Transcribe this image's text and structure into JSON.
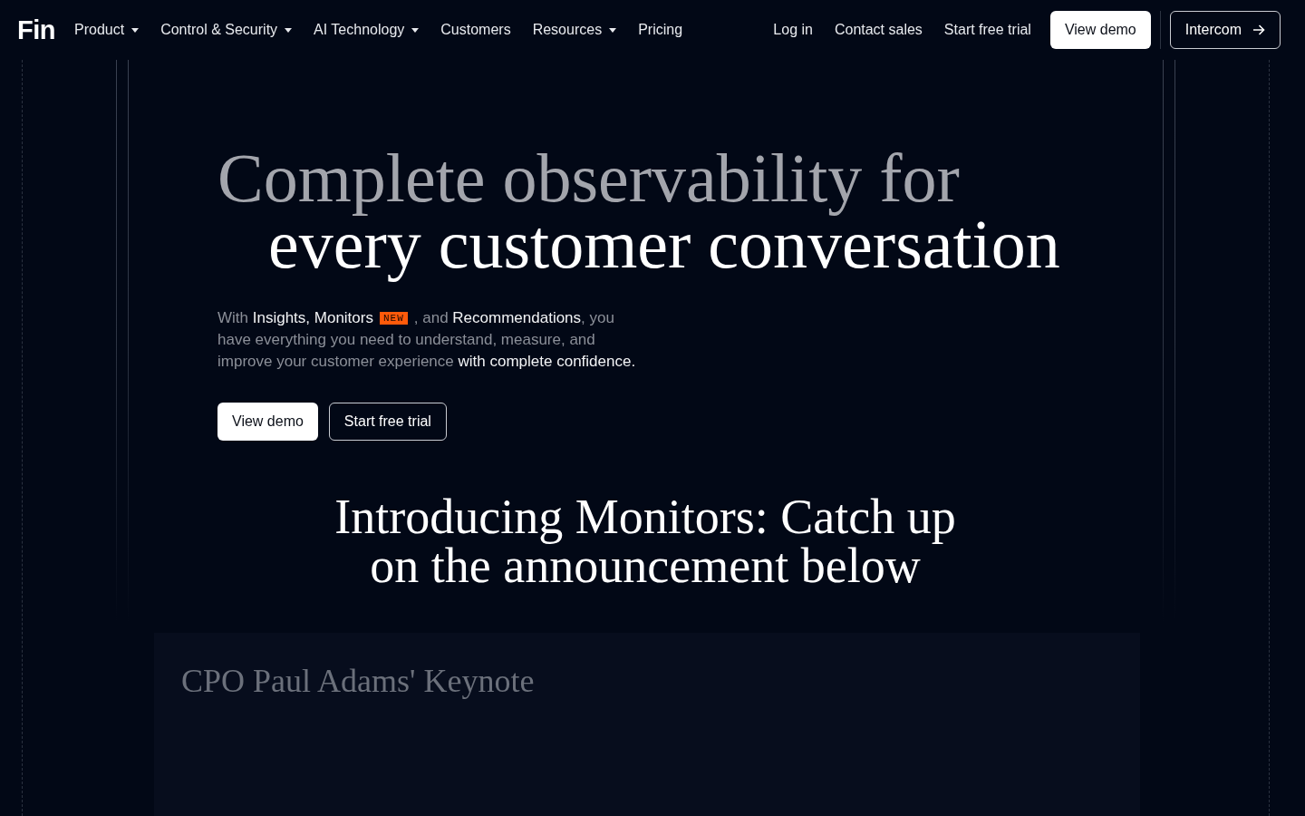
{
  "nav": {
    "logo": "Fin",
    "links": [
      {
        "label": "Product",
        "has_menu": true
      },
      {
        "label": "Control & Security",
        "has_menu": true
      },
      {
        "label": "AI Technology",
        "has_menu": true
      },
      {
        "label": "Customers",
        "has_menu": false
      },
      {
        "label": "Resources",
        "has_menu": true
      },
      {
        "label": "Pricing",
        "has_menu": false
      }
    ],
    "actions": [
      {
        "label": "Log in",
        "kind": "link"
      },
      {
        "label": "Contact sales",
        "kind": "link"
      },
      {
        "label": "Start free trial",
        "kind": "link"
      },
      {
        "label": "View demo",
        "kind": "primary"
      },
      {
        "label": "Intercom",
        "kind": "outline_arrow"
      }
    ]
  },
  "hero": {
    "headline_lead": "Complete observability for",
    "headline_main": "every customer conversation",
    "intro": [
      {
        "kind": "text",
        "text": "With ",
        "highlight": false
      },
      {
        "kind": "text",
        "text": "Insights, Monitors",
        "highlight": true
      },
      {
        "kind": "badge",
        "text": "NEW"
      },
      {
        "kind": "text",
        "text": ", and ",
        "highlight": false
      },
      {
        "kind": "text",
        "text": "Recommendations",
        "highlight": true
      },
      {
        "kind": "text",
        "text": ", you have everything you need to understand, measure, and improve your customer experience ",
        "highlight": false
      },
      {
        "kind": "text",
        "text": "with complete confidence.",
        "highlight": true
      }
    ],
    "buttons": [
      {
        "label": "View demo",
        "kind": "primary"
      },
      {
        "label": "Start free trial",
        "kind": "outline"
      }
    ]
  },
  "announcement": {
    "heading": "Introducing Monitors: Catch up on the announcement below"
  },
  "keynote": {
    "title": "CPO Paul Adams' Keynote"
  }
}
